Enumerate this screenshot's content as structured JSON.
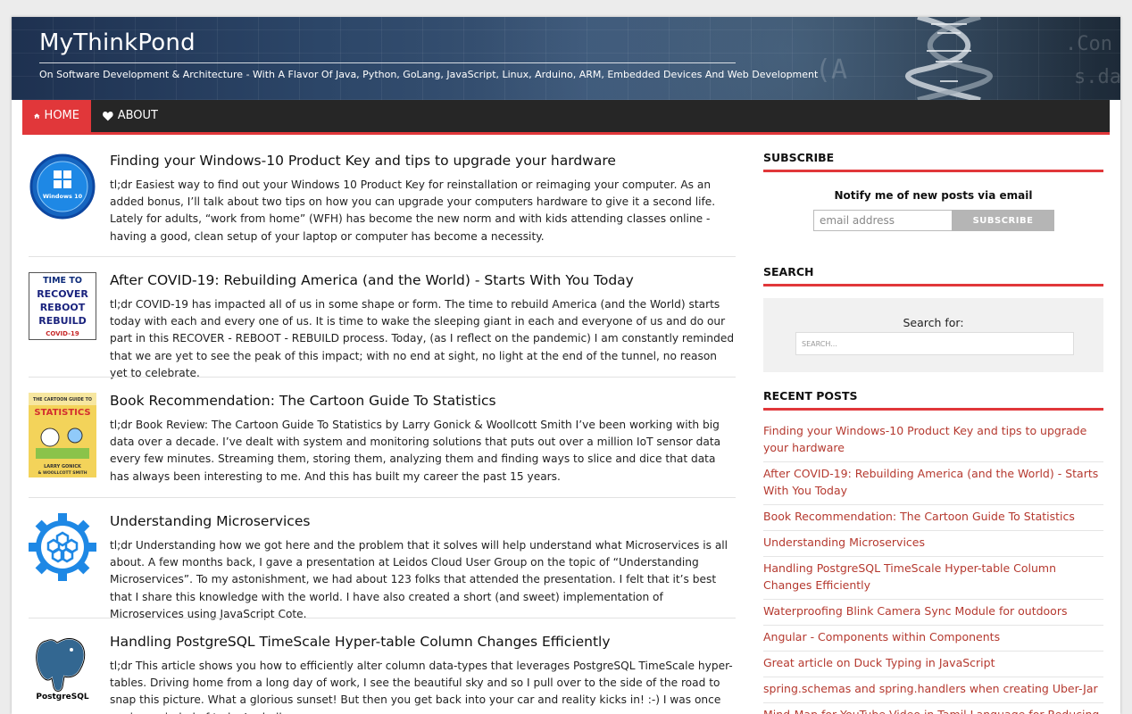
{
  "header": {
    "site_title": "MyThinkPond",
    "tagline": "On Software Development & Architecture - With A Flavor Of Java, Python, GoLang, JavaScript, Linux, Arduino, ARM, Embedded Devices And Web Development"
  },
  "nav": {
    "items": [
      {
        "label": "HOME",
        "icon": "home-icon",
        "active": true
      },
      {
        "label": "ABOUT",
        "icon": "heart-icon",
        "active": false
      }
    ]
  },
  "posts": [
    {
      "title": "Finding your Windows-10 Product Key and tips to upgrade your hardware",
      "excerpt": "tl;dr Easiest way to find out your Windows 10 Product Key for reinstallation or reimaging your computer. As an added bonus, I’ll talk about two tips on how you can upgrade your computers hardware to give it a second life. Lately for adults, “work from home” (WFH) has become the new norm and with kids attending classes online - having a good, clean setup of your laptop or computer has become a necessity.",
      "thumb_text": "Windows 10"
    },
    {
      "title": "After COVID-19: Rebuilding America (and the World) - Starts With You Today",
      "excerpt": "tl;dr COVID-19 has impacted all of us in some shape or form. The time to rebuild America (and the World) starts today with each and every one of us. It is time to wake the sleeping giant in each and everyone of us and do our part in this RECOVER - REBOOT - REBUILD process. Today, (as I reflect on the pandemic) I am constantly reminded that we are yet to see the peak of this impact; with no end at sight, no light at the end of the tunnel, no reason yet to celebrate.",
      "thumb_lines": [
        "TIME TO",
        "RECOVER",
        "REBOOT",
        "REBUILD",
        "COVID-19"
      ]
    },
    {
      "title": "Book Recommendation: The Cartoon Guide To Statistics",
      "excerpt": "tl;dr Book Review: The Cartoon Guide To Statistics by Larry Gonick & Woollcott Smith I’ve been working with big data over a decade. I’ve dealt with system and monitoring solutions that puts out over a million IoT sensor data every few minutes. Streaming them, storing them, analyzing them and finding ways to slice and dice that data has always been interesting to me. And this has built my career the past 15 years.",
      "thumb_lines": [
        "THE CARTOON GUIDE TO",
        "STATISTICS",
        "LARRY GONICK",
        "& WOOLLCOTT SMITH"
      ]
    },
    {
      "title": "Understanding Microservices",
      "excerpt": "tl;dr Understanding how we got here and the problem that it solves will help understand what Microservices is all about. A few months back, I gave a presentation at Leidos Cloud User Group on the topic of “Understanding Microservices”. To my astonishment, we had about 123 folks that attended the presentation. I felt that it’s best that I share this knowledge with the world. I have also created a short (and sweet) implementation of Microservices using JavaScript Cote."
    },
    {
      "title": "Handling PostgreSQL TimeScale Hyper-table Column Changes Efficiently",
      "excerpt": "tl;dr This article shows you how to efficiently alter column data-types that leverages PostgreSQL TimeScale hyper-tables. Driving home from a long day of work, I see the beautiful sky and so I pull over to the side of the road to snap this picture. What a glorious sunset! But then you get back into your car and reality kicks in! :-) I was once again reminded of today’s challenge.",
      "thumb_text": "PostgreSQL"
    }
  ],
  "sidebar": {
    "subscribe": {
      "title": "SUBSCRIBE",
      "notify_text": "Notify me of new posts via email",
      "email_placeholder": "email address",
      "button_label": "SUBSCRIBE"
    },
    "search": {
      "title": "SEARCH",
      "label": "Search for:",
      "placeholder": "SEARCH..."
    },
    "recent_posts": {
      "title": "RECENT POSTS",
      "items": [
        "Finding your Windows-10 Product Key and tips to upgrade your hardware",
        "After COVID-19: Rebuilding America (and the World) - Starts With You Today",
        "Book Recommendation: The Cartoon Guide To Statistics",
        "Understanding Microservices",
        "Handling PostgreSQL TimeScale Hyper-table Column Changes Efficiently",
        "Waterproofing Blink Camera Sync Module for outdoors",
        "Angular - Components within Components",
        "Great article on Duck Typing in JavaScript",
        "spring.schemas and spring.handlers when creating Uber-Jar",
        "Mind-Map for YouTube Video in Tamil Language for Reducing Belly"
      ]
    }
  },
  "colors": {
    "accent": "#e1373a",
    "nav_bg": "#262626",
    "link": "#b5392f"
  }
}
